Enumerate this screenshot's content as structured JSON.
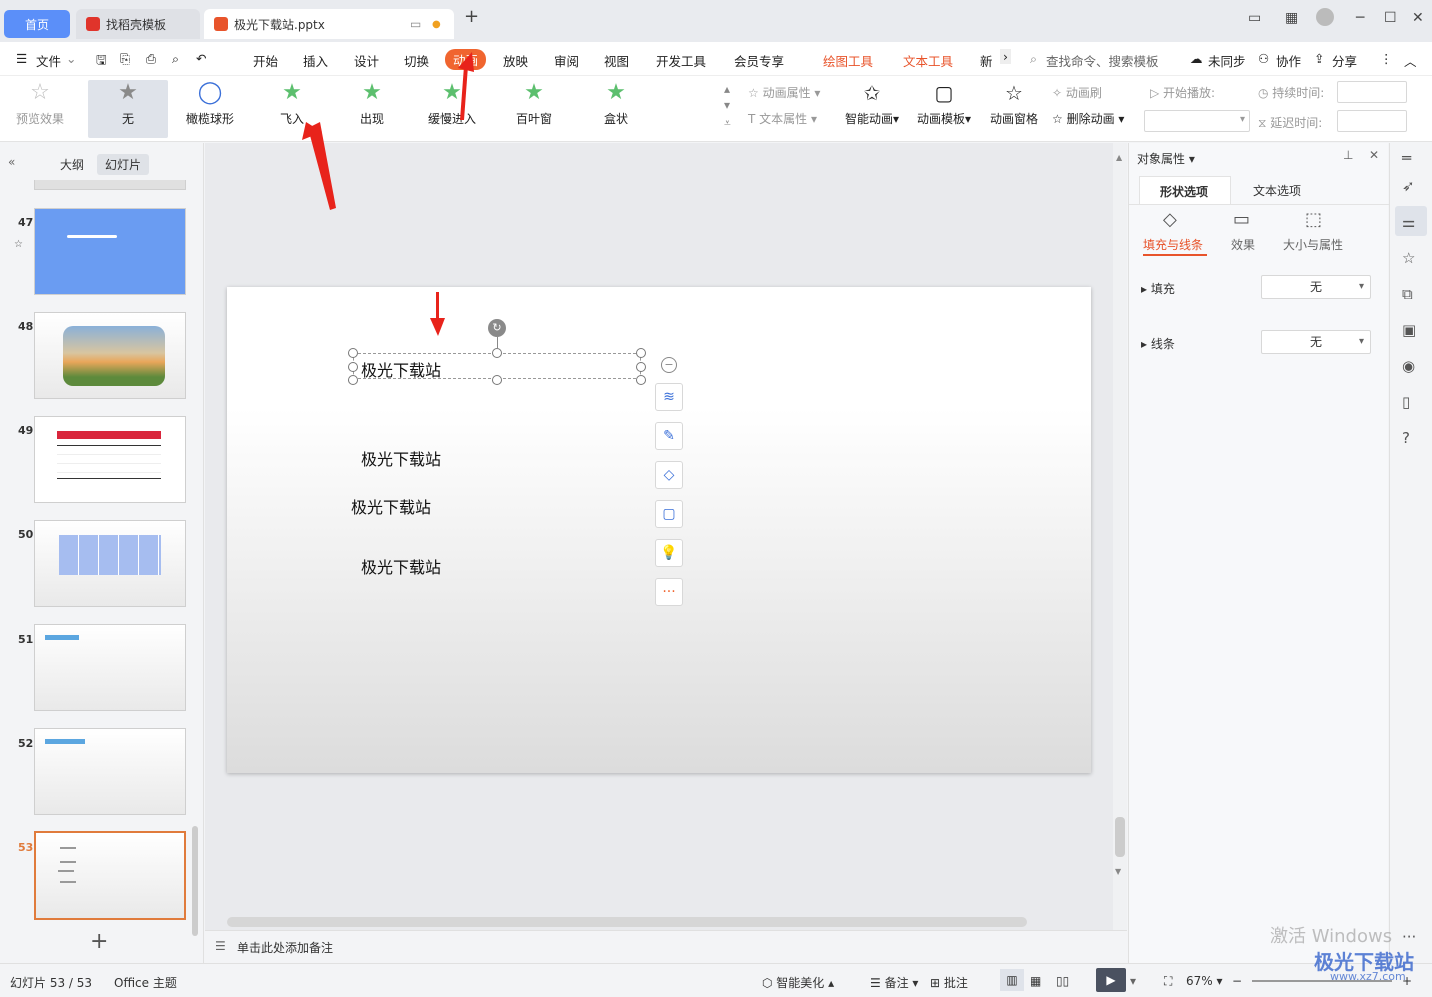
{
  "tabs": {
    "home": "首页",
    "template": "找稻壳模板",
    "file": "极光下载站.pptx"
  },
  "menu": {
    "file": "文件",
    "items": [
      "开始",
      "插入",
      "设计",
      "切换",
      "动画",
      "放映",
      "审阅",
      "视图",
      "开发工具",
      "会员专享"
    ],
    "drawing_tools": "绘图工具",
    "text_tools": "文本工具",
    "new": "新",
    "search": "查找命令、搜索模板",
    "unsynced": "未同步",
    "collab": "协作",
    "share": "分享"
  },
  "ribbon": {
    "preview": "预览效果",
    "effects": [
      "无",
      "橄榄球形",
      "飞入",
      "出现",
      "缓慢进入",
      "百叶窗",
      "盒状"
    ],
    "anim_props": "动画属性",
    "text_props": "文本属性",
    "smart_anim": "智能动画",
    "anim_template": "动画模板",
    "anim_pane": "动画窗格",
    "anim_brush": "动画刷",
    "delete_anim": "删除动画",
    "start_play": "开始播放:",
    "duration": "持续时间:",
    "delay": "延迟时间:"
  },
  "left_panel": {
    "tab_outline": "大纲",
    "tab_slides": "幻灯片",
    "slides": [
      "47",
      "48",
      "49",
      "50",
      "51",
      "52",
      "53"
    ]
  },
  "slide": {
    "texts": [
      "极光下载站",
      "极光下载站",
      "极光下载站",
      "极光下载站"
    ]
  },
  "notes": "单击此处添加备注",
  "right_panel": {
    "title": "对象属性",
    "tab_shape": "形状选项",
    "tab_text": "文本选项",
    "sub_fill_line": "填充与线条",
    "sub_effect": "效果",
    "sub_size": "大小与属性",
    "fill_label": "填充",
    "fill_value": "无",
    "line_label": "线条",
    "line_value": "无"
  },
  "status": {
    "slide_count": "幻灯片 53 / 53",
    "theme": "Office 主题",
    "beautify": "智能美化",
    "notes": "备注",
    "comment": "批注",
    "zoom": "67%"
  },
  "watermark": {
    "activate": "激活 Windows",
    "site": "极光下载站",
    "url": "www.xz7.com"
  },
  "colors": {
    "accent": "#f0652f",
    "home_tab": "#5b8ff9",
    "selected_thumb": "#e07b3c"
  }
}
